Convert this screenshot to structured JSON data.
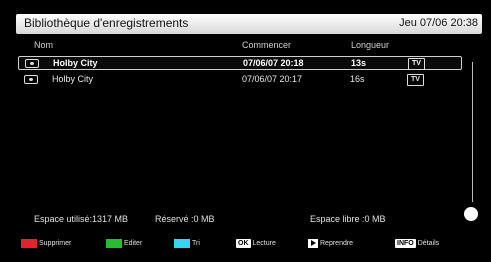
{
  "header": {
    "title": "Bibliothèque d'enregistrements",
    "clock": "Jeu 07/06 20:38"
  },
  "columns": {
    "name": "Nom",
    "start": "Commencer",
    "length": "Longueur"
  },
  "recordings": [
    {
      "name": "Holby City",
      "start": "07/06/07  20:18",
      "length": "13s",
      "type": "TV",
      "selected": true
    },
    {
      "name": "Holby City",
      "start": "07/06/07  20:17",
      "length": "16s",
      "type": "TV",
      "selected": false
    }
  ],
  "status": {
    "used": "Espace utilisé:1317 MB",
    "reserved": "Réservé :0 MB",
    "free": "Espace libre :0 MB"
  },
  "legend": {
    "red": {
      "label": "Supprimer",
      "color": "#e8202a"
    },
    "green": {
      "label": "Editer",
      "color": "#22c02a"
    },
    "cyan": {
      "label": "Tri",
      "color": "#30d8f0"
    },
    "ok": {
      "key": "OK",
      "label": "Lecture"
    },
    "play": {
      "key_icon": "play-icon",
      "label": "Reprendre"
    },
    "info": {
      "key": "INFO",
      "label": "Détails"
    }
  }
}
